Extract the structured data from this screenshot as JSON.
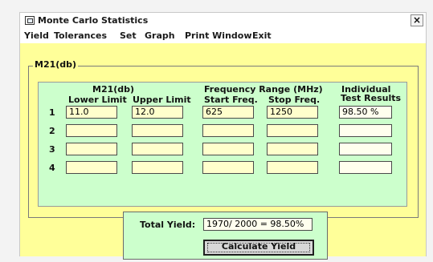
{
  "window": {
    "title": "Monte Carlo Statistics",
    "close_label": "×"
  },
  "menu": [
    "Yield",
    "Tolerances",
    "Set",
    "Graph",
    "Print Window",
    "Exit"
  ],
  "groupbox": {
    "label": "M21(db)",
    "section_m21": "M21(db)",
    "section_freq": "Frequency Range (MHz)",
    "section_results_1": "Individual",
    "section_results_2": "Test Results",
    "headers": [
      "Lower Limit",
      "Upper Limit",
      "Start Freq.",
      "Stop Freq."
    ],
    "rows": [
      {
        "num": "1",
        "lower": "11.0",
        "upper": "12.0",
        "start": "625",
        "stop": "1250",
        "result": "98.50 %"
      },
      {
        "num": "2",
        "lower": "",
        "upper": "",
        "start": "",
        "stop": "",
        "result": ""
      },
      {
        "num": "3",
        "lower": "",
        "upper": "",
        "start": "",
        "stop": "",
        "result": ""
      },
      {
        "num": "4",
        "lower": "",
        "upper": "",
        "start": "",
        "stop": "",
        "result": ""
      }
    ]
  },
  "yield": {
    "total_label": "Total Yield:",
    "total_value": "1970/ 2000 = 98.50%",
    "button_label": "Calculate Yield"
  },
  "colors": {
    "client_bg": "#ffff99",
    "panel_bg": "#ccffcc",
    "field_bg": "#ffffcc"
  }
}
